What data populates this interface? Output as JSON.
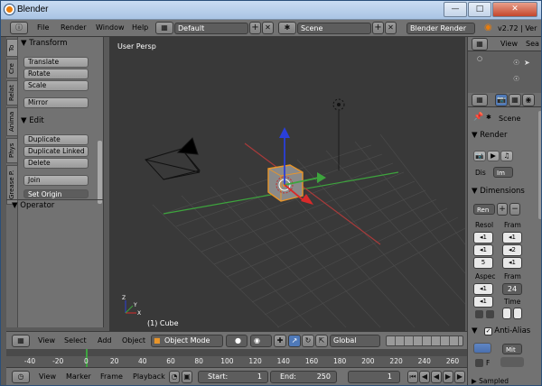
{
  "window": {
    "title": "Blender",
    "controls": [
      "—",
      "□",
      "✕"
    ]
  },
  "info_header": {
    "menus": [
      "File",
      "Render",
      "Window",
      "Help"
    ],
    "screen_layout": "Default",
    "scene": "Scene",
    "engine": "Blender Render",
    "version": "v2.72 | Ver"
  },
  "tool_tabs": [
    "To",
    "Cre",
    "Relat",
    "Anima",
    "Phys",
    "Grease P."
  ],
  "tool_shelf": {
    "transform_header": "Transform",
    "transform_buttons": [
      "Translate",
      "Rotate",
      "Scale"
    ],
    "mirror": "Mirror",
    "edit_header": "Edit",
    "edit_buttons": [
      "Duplicate",
      "Duplicate Linked",
      "Delete"
    ],
    "join": "Join",
    "set_origin": "Set Origin",
    "operator_header": "Operator"
  },
  "viewport": {
    "label": "User Persp",
    "selection": "(1) Cube",
    "axis_x": "X",
    "axis_y": "Y",
    "axis_z": "Z"
  },
  "sidebar": {
    "view_tab": "View",
    "search_tab": "Sea",
    "scene_label": "Scene",
    "render_header": "Render",
    "display_label": "Dis",
    "display_value": "Im",
    "dimensions_header": "Dimensions",
    "preset": "Ren",
    "resolution_label": "Resol",
    "frame_label": "Fram",
    "res_values": [
      "◂1",
      "◂1",
      "5"
    ],
    "frame_values": [
      "◂1",
      "◂2",
      "◂1"
    ],
    "aspect_label": "Aspec",
    "aspect_values": [
      "◂1",
      "◂1"
    ],
    "frame_rate_label": "Fram",
    "frame_rate": "24",
    "time_label": "Time",
    "anti_alias_header": "Anti-Alias",
    "aa_value": "Mit",
    "aa_f": "F",
    "sampled": "Sampled"
  },
  "viewport_header": {
    "menus": [
      "View",
      "Select",
      "Add",
      "Object"
    ],
    "mode": "Object Mode",
    "orientation": "Global"
  },
  "timeline": {
    "ticks": [
      "-40",
      "-20",
      "0",
      "20",
      "40",
      "60",
      "80",
      "100",
      "120",
      "140",
      "160",
      "180",
      "200",
      "220",
      "240",
      "260"
    ]
  },
  "timeline_header": {
    "menus": [
      "View",
      "Marker",
      "Frame",
      "Playback"
    ],
    "start_label": "Start:",
    "start_value": "1",
    "end_label": "End:",
    "end_value": "250",
    "current_frame": "1"
  }
}
